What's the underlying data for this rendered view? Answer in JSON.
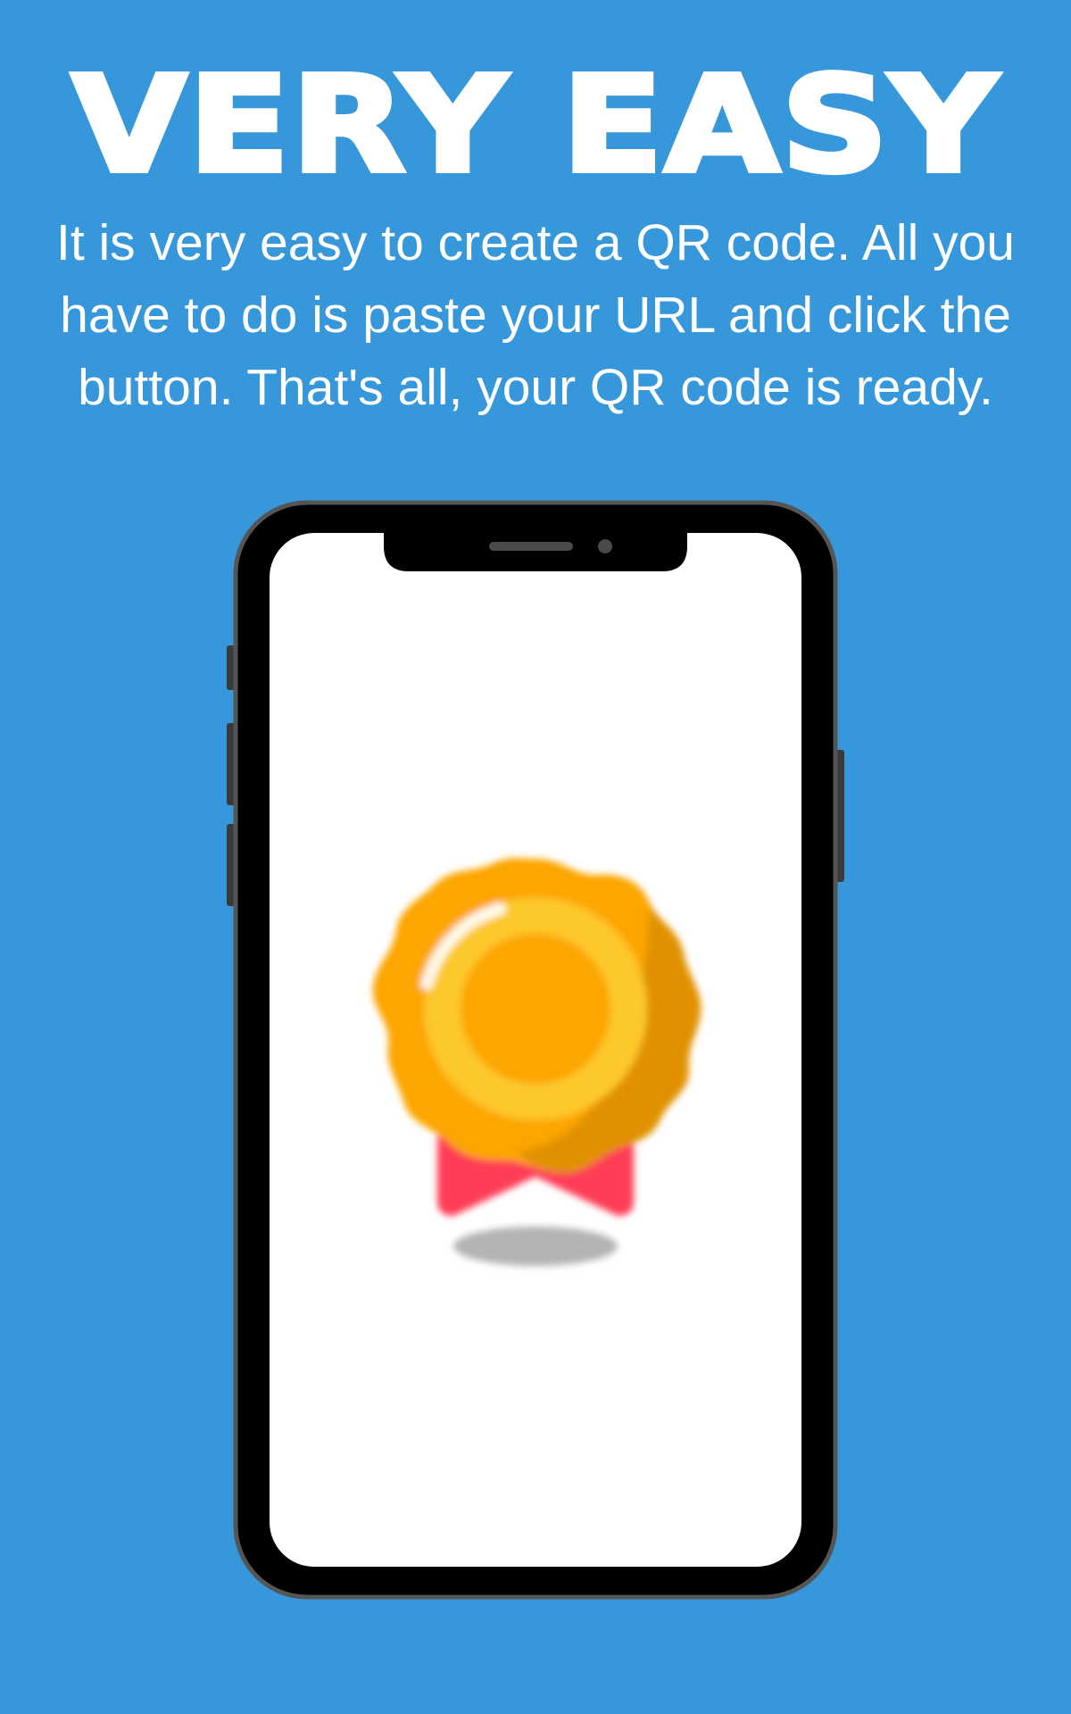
{
  "headline": "VERY EASY",
  "description": "It is very easy to create a QR code. All you have to do is paste your URL and click the button. That's all, your QR code is ready.",
  "colors": {
    "background": "#3797db",
    "text": "#ffffff",
    "phone_body": "#000000",
    "phone_frame": "#555555",
    "screen": "#ffffff",
    "medal_outer": "#fda505",
    "medal_ring": "#fdc82a",
    "ribbon": "#ff3d57"
  },
  "screen": {
    "icon": "medal-icon"
  }
}
